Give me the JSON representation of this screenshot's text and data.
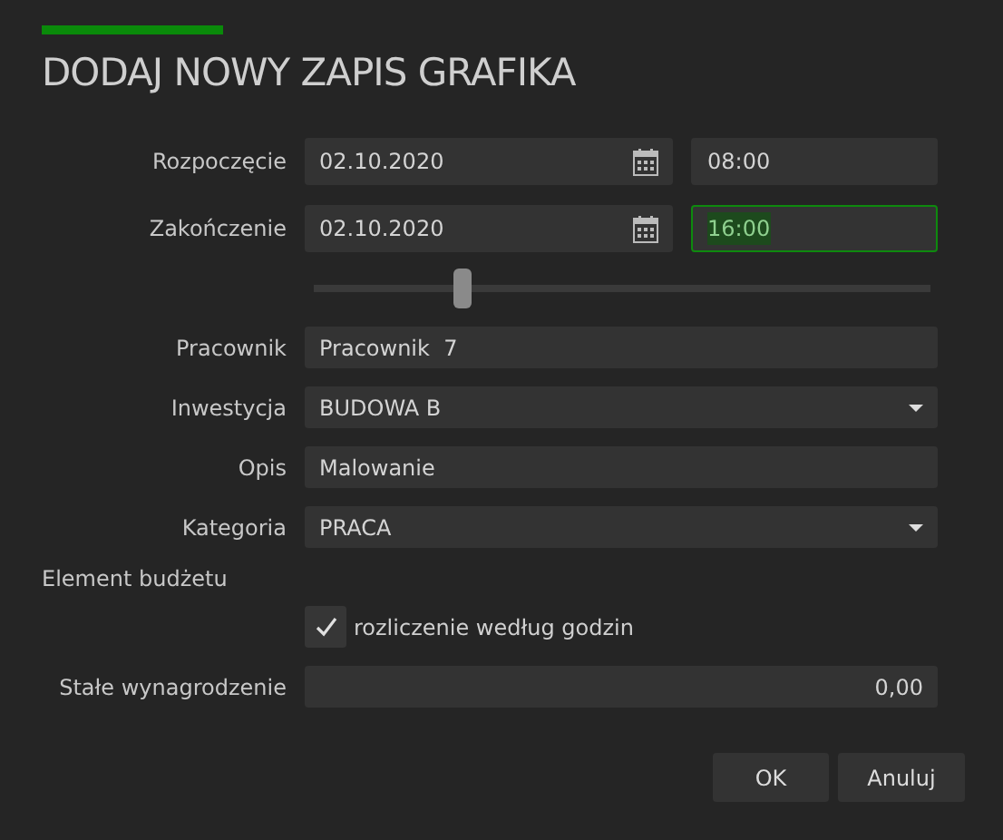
{
  "title": "DODAJ NOWY ZAPIS GRAFIKA",
  "rows": [
    {
      "kind": "datetime",
      "label": "Rozpoczęcie",
      "date": "02.10.2020",
      "time": "08:00",
      "time_focused": false
    },
    {
      "kind": "datetime",
      "label": "Zakończenie",
      "date": "02.10.2020",
      "time": "16:00",
      "time_focused": true
    },
    {
      "kind": "slider",
      "level": 0.24
    },
    {
      "kind": "text",
      "label": "Pracownik",
      "value": "Pracownik  7"
    },
    {
      "kind": "dropdown",
      "label": "Inwestycja",
      "value": "BUDOWA B"
    },
    {
      "kind": "text",
      "label": "Opis",
      "value": "Malowanie"
    },
    {
      "kind": "dropdown",
      "label": "Kategoria",
      "value": "PRACA"
    },
    {
      "kind": "section",
      "label": "Element budżetu"
    },
    {
      "kind": "checkbox",
      "label": "rozliczenie według godzin",
      "checked": true
    },
    {
      "kind": "number",
      "label": "Stałe wynagrodzenie",
      "value": "0,00"
    }
  ],
  "buttons": [
    "OK",
    "Anuluj"
  ]
}
